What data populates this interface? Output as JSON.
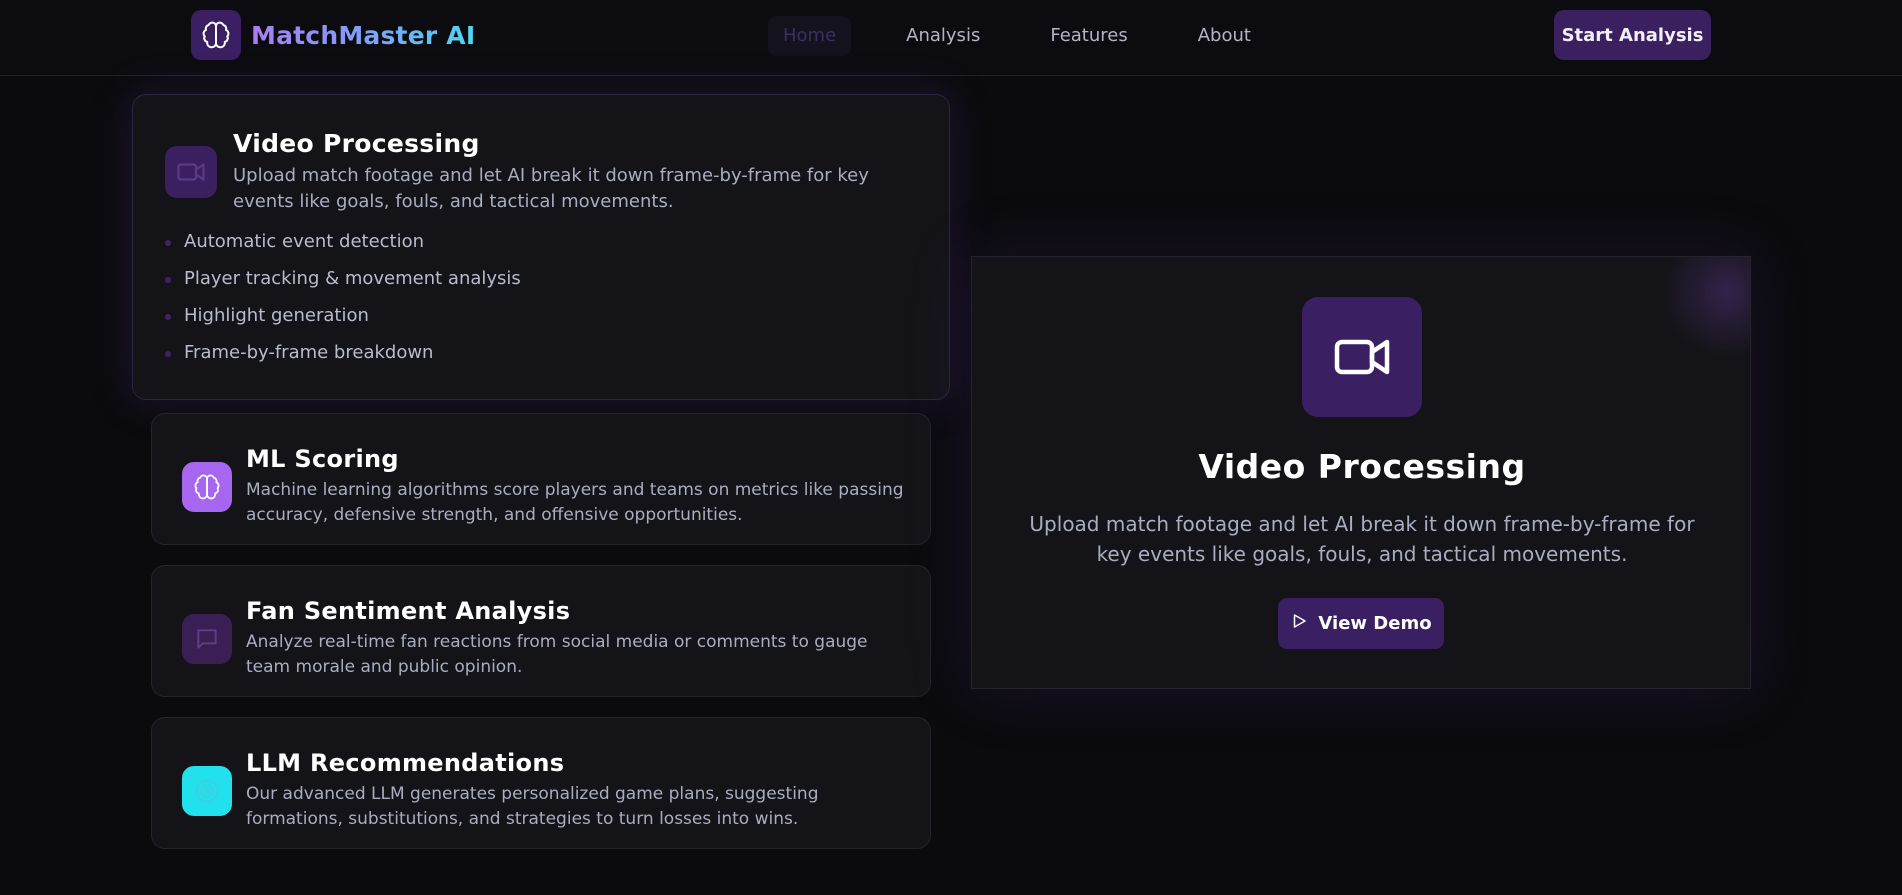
{
  "header": {
    "logo_text": "MatchMaster AI",
    "nav": [
      {
        "label": "Home",
        "active": true
      },
      {
        "label": "Analysis",
        "active": false
      },
      {
        "label": "Features",
        "active": false
      },
      {
        "label": "About",
        "active": false
      }
    ],
    "cta_label": "Start Analysis"
  },
  "features": [
    {
      "title": "Video Processing",
      "description": "Upload match footage and let AI break it down frame-by-frame for key events like goals, fouls, and tactical movements.",
      "icon": "video-camera-icon",
      "bullets": [
        "Automatic event detection",
        "Player tracking & movement analysis",
        "Highlight generation",
        "Frame-by-frame breakdown"
      ]
    },
    {
      "title": "ML Scoring",
      "description": "Machine learning algorithms score players and teams on metrics like passing accuracy, defensive strength, and offensive opportunities.",
      "icon": "brain-icon",
      "icon_color": "#a766f0"
    },
    {
      "title": "Fan Sentiment Analysis",
      "description": "Analyze real-time fan reactions from social media or comments to gauge team morale and public opinion.",
      "icon": "chat-bubble-icon",
      "icon_color": "#3a1f55"
    },
    {
      "title": "LLM Recommendations",
      "description": "Our advanced LLM generates personalized game plans, suggesting formations, substitutions, and strategies to turn losses into wins.",
      "icon": "target-icon",
      "icon_color": "#22e1ec"
    }
  ],
  "showcase": {
    "title": "Video Processing",
    "description": "Upload match footage and let AI break it down frame-by-frame for key events like goals, fouls, and tactical movements.",
    "icon": "video-camera-icon",
    "button_label": "View Demo",
    "button_icon": "play-icon"
  },
  "colors": {
    "background": "#0b0b0e",
    "accent_purple": "#3a1f62",
    "card_bg": "#141418",
    "text_muted": "#a9adbd"
  }
}
